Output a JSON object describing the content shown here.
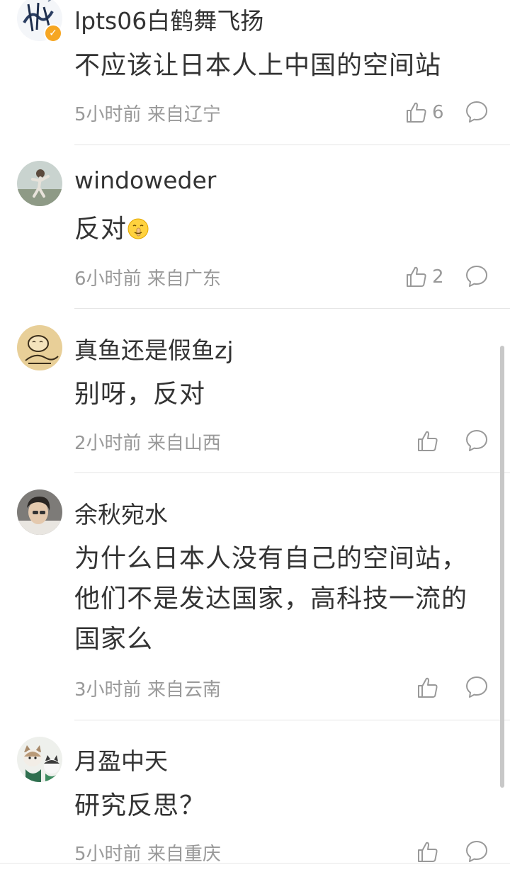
{
  "comments": [
    {
      "username": "lpts06白鹤舞飞扬",
      "content": "不应该让日本人上中国的空间站",
      "time": "5小时前",
      "location": "来自辽宁",
      "likes": "6",
      "avatar_text": "准",
      "verified": true
    },
    {
      "username": "windoweder",
      "content": "反对",
      "emoji": "shushing-face",
      "time": "6小时前",
      "location": "来自广东",
      "likes": "2"
    },
    {
      "username": "真鱼还是假鱼zj",
      "content": "别呀，反对",
      "time": "2小时前",
      "location": "来自山西",
      "likes": ""
    },
    {
      "username": "余秋宛水",
      "content": "为什么日本人没有自己的空间站，他们不是发达国家，高科技一流的国家么",
      "time": "3小时前",
      "location": "来自云南",
      "likes": ""
    },
    {
      "username": "月盈中天",
      "content": "研究反思？",
      "time": "5小时前",
      "location": "来自重庆",
      "likes": ""
    }
  ],
  "icons": {
    "like": "thumbs-up-outline-icon",
    "reply": "speech-bubble-outline-icon",
    "verified": "verified-badge-icon"
  },
  "colors": {
    "text": "#333333",
    "meta": "#999999",
    "divider": "#e6e6e6",
    "verified": "#f6a622"
  }
}
